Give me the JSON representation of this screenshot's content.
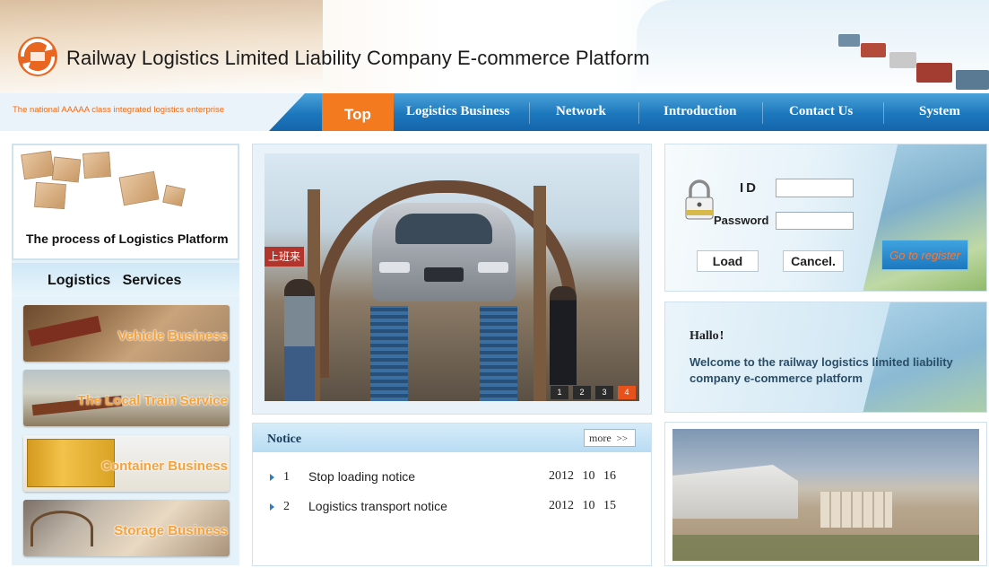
{
  "header": {
    "title": "Railway Logistics Limited Liability Company E-commerce Platform",
    "tagline": "The national AAAAA class integrated logistics enterprise"
  },
  "nav": {
    "items": [
      {
        "label": "Top",
        "active": true
      },
      {
        "label": "Logistics Business"
      },
      {
        "label": "Network"
      },
      {
        "label": "Introduction"
      },
      {
        "label": "Contact Us"
      },
      {
        "label": "System"
      }
    ]
  },
  "left": {
    "process_label": "The process of Logistics Platform",
    "services_title": "Logistics   Services",
    "services": [
      {
        "label": "Vehicle Business"
      },
      {
        "label": "The Local Train Service"
      },
      {
        "label": "Container Business"
      },
      {
        "label": "Storage Business"
      }
    ]
  },
  "slideshow": {
    "sign_text": "上班来",
    "pages": [
      "1",
      "2",
      "3",
      "4"
    ],
    "active_page": "4"
  },
  "notice": {
    "title": "Notice",
    "more_label": "more",
    "more_icon": "double-chevron-right",
    "items": [
      {
        "num": "1",
        "title": "Stop loading notice",
        "date": "2012 10 16"
      },
      {
        "num": "2",
        "title": "Logistics transport notice",
        "date": "2012 10 15"
      }
    ]
  },
  "login": {
    "id_label": "ID",
    "password_label": "Password",
    "load_label": "Load",
    "cancel_label": "Cancel.",
    "register_label": "Go to register",
    "id_value": "",
    "password_value": ""
  },
  "welcome": {
    "greeting": "Hallo",
    "greeting_mark": "!",
    "message": "Welcome to the railway logistics limited liability company e-commerce platform"
  },
  "colors": {
    "nav_blue": "#1d77bd",
    "nav_active": "#f47a1f",
    "tagline": "#f26b16",
    "service_label": "#f5a23a",
    "slide_active_dot": "#e6511c"
  }
}
